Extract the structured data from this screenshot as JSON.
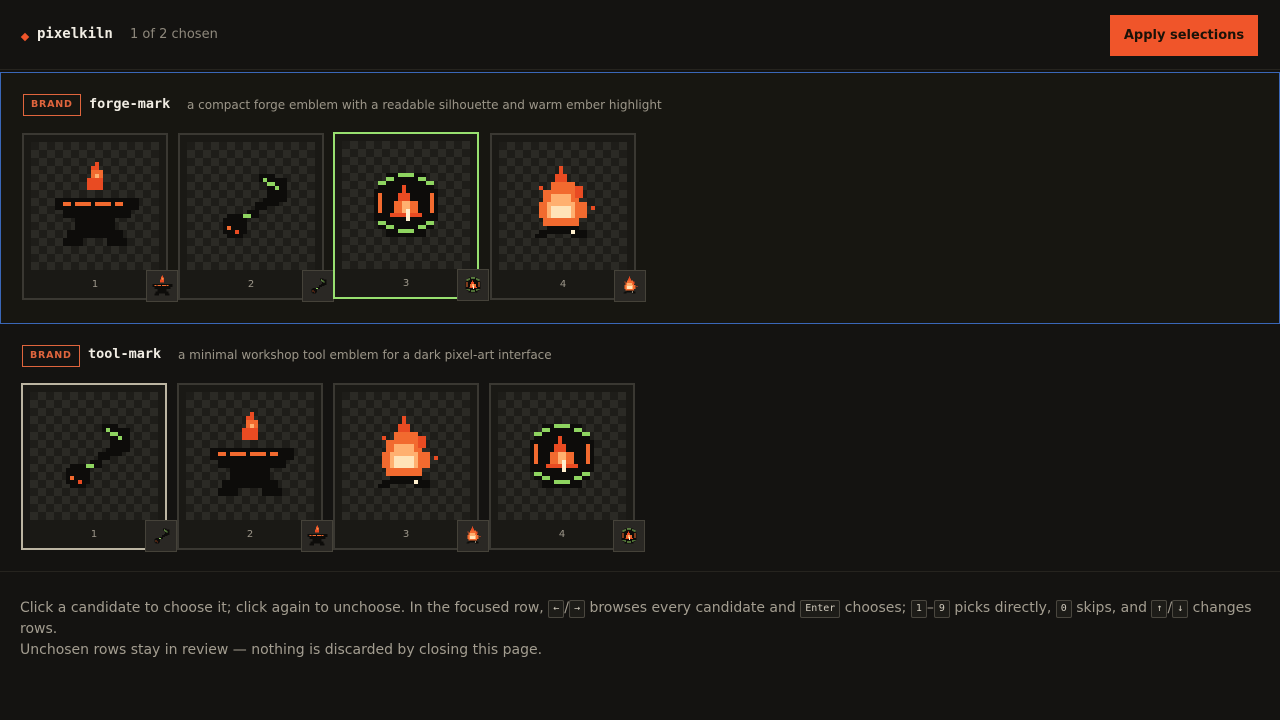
{
  "header": {
    "app_name": "pixelkiln",
    "chosen_count": "1 of 2 chosen",
    "apply_label": "Apply selections"
  },
  "rows": [
    {
      "badge": "BRAND",
      "title": "forge-mark",
      "description": "a compact forge emblem with a readable silhouette and warm ember highlight",
      "selected_index": 3,
      "candidates": [
        {
          "number": "1",
          "icon": "anvil-icon"
        },
        {
          "number": "2",
          "icon": "tool-icon"
        },
        {
          "number": "3",
          "icon": "hex-flame-emblem-icon"
        },
        {
          "number": "4",
          "icon": "campfire-icon"
        }
      ]
    },
    {
      "badge": "BRAND",
      "title": "tool-mark",
      "description": "a minimal workshop tool emblem for a dark pixel-art interface",
      "cursor_index": 1,
      "candidates": [
        {
          "number": "1",
          "icon": "tool-icon"
        },
        {
          "number": "2",
          "icon": "anvil-icon"
        },
        {
          "number": "3",
          "icon": "campfire-icon"
        },
        {
          "number": "4",
          "icon": "hex-flame-emblem-icon"
        }
      ]
    }
  ],
  "help": {
    "t1": "Click a candidate to choose it; click again to unchoose. In the focused row,",
    "k_left": "←",
    "sep1": "/",
    "k_right": "→",
    "t2": "browses every candidate and",
    "k_enter": "Enter",
    "t3": "chooses;",
    "k_1": "1",
    "dash": "–",
    "k_9": "9",
    "t4": "picks directly,",
    "k_0": "0",
    "t5": "skips, and",
    "k_up": "↑",
    "sep2": "/",
    "k_down": "↓",
    "t6": "changes rows.",
    "line2": "Unchosen rows stay in review — nothing is discarded by closing this page."
  },
  "colors": {
    "accent": "#f0552a",
    "selected_border": "#98e070",
    "focus_border": "#3a67b8",
    "background": "#141311"
  }
}
